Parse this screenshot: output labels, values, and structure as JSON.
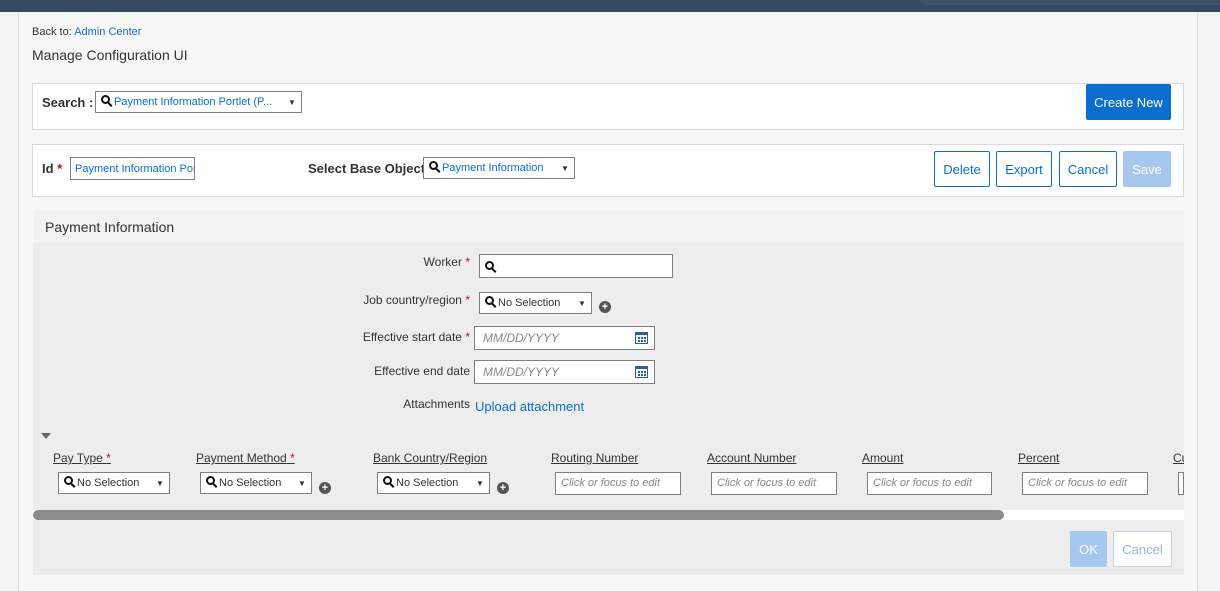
{
  "header": {
    "back_prefix": "Back to:",
    "back_link": "Admin Center",
    "title": "Manage Configuration UI"
  },
  "search": {
    "label": "Search :",
    "value": "Payment Information Portlet (P...",
    "create_label": "Create New"
  },
  "config": {
    "id_label": "Id",
    "id_value": "Payment Information Portlet",
    "base_object_label": "Select Base Object",
    "base_object_value": "Payment Information",
    "buttons": {
      "delete": "Delete",
      "export": "Export",
      "cancel": "Cancel",
      "save": "Save"
    }
  },
  "section": {
    "title": "Payment Information",
    "fields": {
      "worker_label": "Worker",
      "job_country_label": "Job country/region",
      "job_country_value": "No Selection",
      "start_date_label": "Effective start date",
      "start_date_placeholder": "MM/DD/YYYY",
      "end_date_label": "Effective end date",
      "end_date_placeholder": "MM/DD/YYYY",
      "attachments_label": "Attachments",
      "upload_link": "Upload attachment"
    },
    "table": {
      "columns": [
        "Pay Type",
        "Payment Method",
        "Bank Country/Region",
        "Routing Number",
        "Account Number",
        "Amount",
        "Percent",
        "Cu"
      ],
      "row": {
        "pay_type": "No Selection",
        "payment_method": "No Selection",
        "bank_country": "No Selection",
        "edit_placeholder": "Click or focus to edit"
      }
    }
  },
  "footer": {
    "ok": "OK",
    "cancel": "Cancel"
  },
  "colors": {
    "accent": "#0a6ed1",
    "required": "#d0021b",
    "topbar": "#354a5f"
  }
}
